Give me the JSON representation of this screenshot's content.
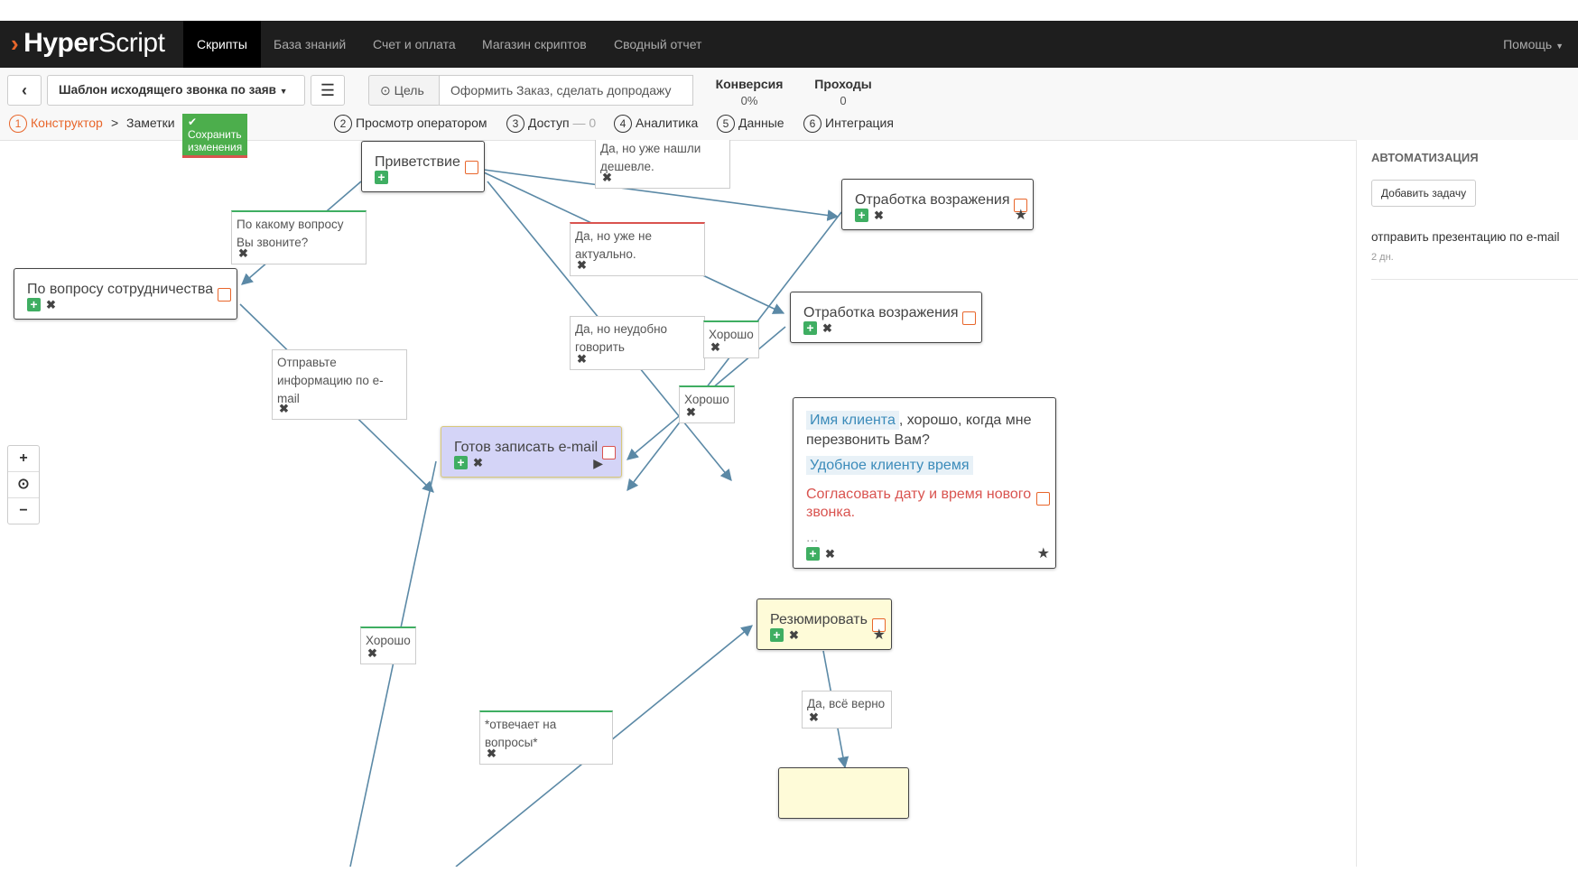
{
  "app": {
    "logo_bold": "Hyper",
    "logo_thin": "Script"
  },
  "nav": {
    "items": [
      "Скрипты",
      "База знаний",
      "Счет и оплата",
      "Магазин скриптов",
      "Сводный отчет"
    ],
    "help": "Помощь"
  },
  "toolbar": {
    "script_name": "Шаблон исходящего звонка по заяв",
    "goal_label": "Цель",
    "goal_value": "Оформить Заказ, сделать допродажу",
    "conversion_label": "Конверсия",
    "conversion_value": "0%",
    "passes_label": "Проходы",
    "passes_value": "0"
  },
  "steps": {
    "constructor": "Конструктор",
    "separator": ">",
    "notes": "Заметки",
    "save": "Сохранить изменения",
    "operator_view": "Просмотр оператором",
    "access": "Доступ",
    "access_count": "— 0",
    "analytics": "Аналитика",
    "data": "Данные",
    "integration": "Интеграция",
    "n1": "1",
    "n2": "2",
    "n3": "3",
    "n4": "4",
    "n5": "5",
    "n6": "6"
  },
  "nodes": {
    "greeting": "Приветствие",
    "cooperation": "По вопросу сотрудничества",
    "objection1": "Отработка возражения",
    "objection2": "Отработка возражения",
    "email": "Готов записать e-mail",
    "summarize": "Резюмировать",
    "callback_tag1": "Имя клиента",
    "callback_text1": ", хорошо, когда мне перезвонить Вам?",
    "callback_tag2": "Удобное клиенту время",
    "callback_text2": "Согласовать дату и время нового звонка.",
    "callback_more": "..."
  },
  "edges": {
    "which_question": "По какому вопросу Вы звоните?",
    "found_cheaper": "Да, но уже нашли дешевле.",
    "not_relevant": "Да, но уже не актуально.",
    "inconvenient": "Да, но неудобно говорить",
    "ok1": "Хорошо",
    "ok2": "Хорошо",
    "send_info": "Отправьте информацию по e-mail",
    "ok3": "Хорошо",
    "answers": "*отвечает на вопросы*",
    "all_correct": "Да, всё верно"
  },
  "sidebar": {
    "header": "АВТОМАТИЗАЦИЯ",
    "add_task": "Добавить задачу",
    "task_title": "отправить презентацию по e-mail",
    "task_time": "2 дн."
  },
  "zoom": {
    "in": "+",
    "reset": "⊙",
    "out": "−"
  }
}
